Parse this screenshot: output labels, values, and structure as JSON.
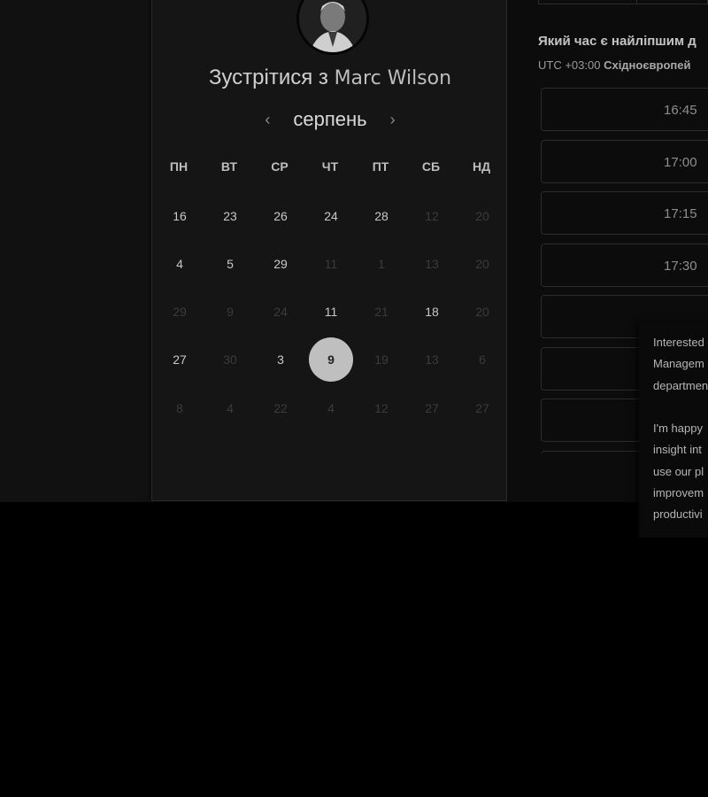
{
  "booking": {
    "title_prefix": "Зустрітися з",
    "host_name": "Marc Wilson",
    "month": "серпень",
    "prev_month_icon": "‹",
    "next_month_icon": "›"
  },
  "calendar": {
    "weekdays": [
      "ПН",
      "ВТ",
      "СР",
      "ЧТ",
      "ПТ",
      "СБ",
      "НД"
    ],
    "weeks": [
      [
        {
          "d": "16",
          "s": "active"
        },
        {
          "d": "23",
          "s": "active"
        },
        {
          "d": "26",
          "s": "active"
        },
        {
          "d": "24",
          "s": "active"
        },
        {
          "d": "28",
          "s": "active"
        },
        {
          "d": "12",
          "s": "faded"
        },
        {
          "d": "20",
          "s": "faded"
        }
      ],
      [
        {
          "d": "4",
          "s": "active"
        },
        {
          "d": "5",
          "s": "active"
        },
        {
          "d": "29",
          "s": "active"
        },
        {
          "d": "11",
          "s": "faded"
        },
        {
          "d": "1",
          "s": "faded"
        },
        {
          "d": "13",
          "s": "faded"
        },
        {
          "d": "20",
          "s": "faded"
        }
      ],
      [
        {
          "d": "29",
          "s": "faded"
        },
        {
          "d": "9",
          "s": "faded"
        },
        {
          "d": "24",
          "s": "faded"
        },
        {
          "d": "11",
          "s": "active"
        },
        {
          "d": "21",
          "s": "faded"
        },
        {
          "d": "18",
          "s": "active"
        },
        {
          "d": "20",
          "s": "faded"
        }
      ],
      [
        {
          "d": "27",
          "s": "active"
        },
        {
          "d": "30",
          "s": "faded"
        },
        {
          "d": "3",
          "s": "active"
        },
        {
          "d": "9",
          "s": "selected"
        },
        {
          "d": "19",
          "s": "faded"
        },
        {
          "d": "13",
          "s": "faded"
        },
        {
          "d": "6",
          "s": "faded"
        }
      ],
      [
        {
          "d": "8",
          "s": "faded"
        },
        {
          "d": "4",
          "s": "faded"
        },
        {
          "d": "22",
          "s": "faded"
        },
        {
          "d": "4",
          "s": "faded"
        },
        {
          "d": "12",
          "s": "faded"
        },
        {
          "d": "27",
          "s": "faded"
        },
        {
          "d": "27",
          "s": "faded"
        }
      ]
    ]
  },
  "times": {
    "question": "Який час є найліпшим д",
    "timezone_prefix": "UTC +03:00",
    "timezone_name": "Східноєвропей",
    "slots": [
      "16:45",
      "17:00",
      "17:15",
      "17:30",
      "",
      "",
      "",
      ""
    ]
  },
  "chat": {
    "lines": [
      "Interested",
      "Managem",
      "departmen",
      "",
      "I'm happy",
      "insight int",
      "use our pl",
      "improvem",
      "productivi"
    ]
  }
}
